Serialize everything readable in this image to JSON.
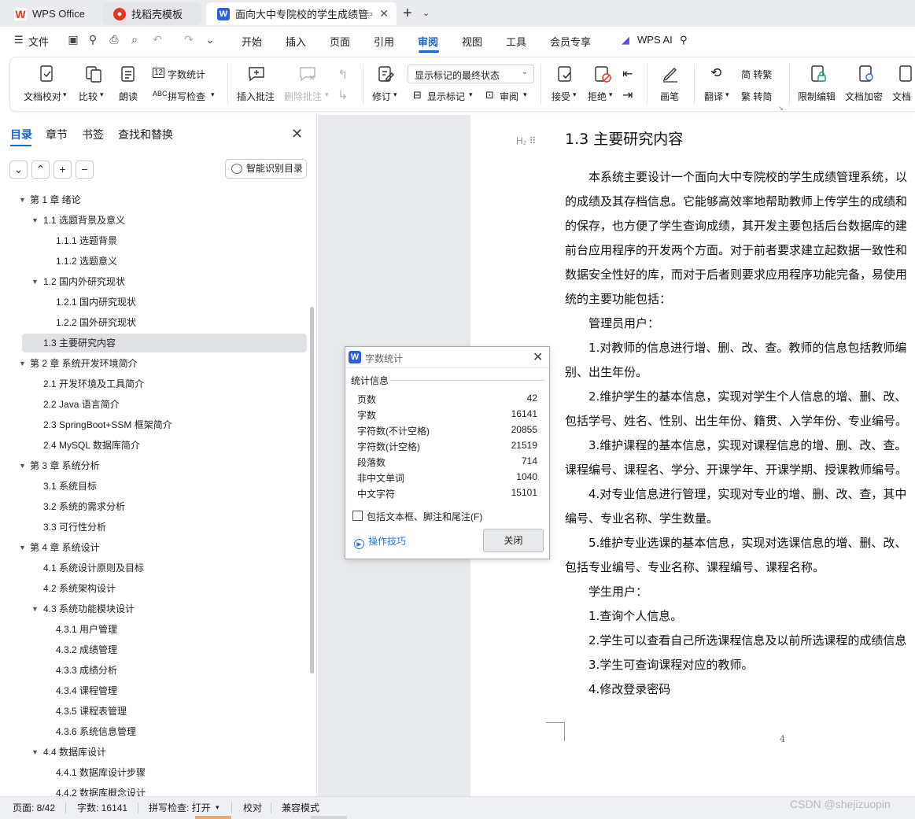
{
  "tabs": {
    "wps": "WPS Office",
    "daoke": "找稻壳模板",
    "doc": "面向大中专院校的学生成绩管理"
  },
  "menubar": {
    "file": "文件",
    "items": [
      "开始",
      "插入",
      "页面",
      "引用",
      "审阅",
      "视图",
      "工具",
      "会员专享"
    ],
    "active": "审阅",
    "wps_ai": "WPS AI"
  },
  "ribbon": {
    "doc_proofread": "文档校对",
    "compare": "比较",
    "read_aloud": "朗读",
    "word_count": "字数统计",
    "spell_check": "拼写检查",
    "insert_comment": "插入批注",
    "delete_comment": "删除批注",
    "revise": "修订",
    "display_state": "显示标记的最终状态",
    "show_markup": "显示标记",
    "review": "审阅",
    "accept": "接受",
    "reject": "拒绝",
    "pen": "画笔",
    "translate": "翻译",
    "to_traditional": "简 转繁",
    "to_simplified": "繁 转简",
    "restrict_edit": "限制编辑",
    "encrypt": "文档加密",
    "doc_more": "文档"
  },
  "nav": {
    "tabs": [
      "目录",
      "章节",
      "书签",
      "查找和替换"
    ],
    "smart_toc": "智能识别目录",
    "toc": [
      {
        "level": 1,
        "text": "第 1 章  绪论",
        "caret": true
      },
      {
        "level": 2,
        "text": "1.1  选题背景及意义",
        "caret": true
      },
      {
        "level": 3,
        "text": "1.1.1 选题背景"
      },
      {
        "level": 3,
        "text": "1.1.2 选题意义"
      },
      {
        "level": 2,
        "text": "1.2  国内外研究现状",
        "caret": true
      },
      {
        "level": 3,
        "text": "1.2.1 国内研究现状"
      },
      {
        "level": 3,
        "text": "1.2.2 国外研究现状"
      },
      {
        "level": 2,
        "text": "1.3  主要研究内容",
        "selected": true
      },
      {
        "level": 1,
        "text": "第 2 章  系统开发环境简介",
        "caret": true
      },
      {
        "level": 2,
        "text": "2.1  开发环境及工具简介"
      },
      {
        "level": 2,
        "text": "2.2 Java 语言简介"
      },
      {
        "level": 2,
        "text": "2.3 SpringBoot+SSM 框架简介"
      },
      {
        "level": 2,
        "text": "2.4 MySQL 数据库简介"
      },
      {
        "level": 1,
        "text": "第 3 章  系统分析",
        "caret": true
      },
      {
        "level": 2,
        "text": "3.1  系统目标"
      },
      {
        "level": 2,
        "text": "3.2  系统的需求分析"
      },
      {
        "level": 2,
        "text": "3.3  可行性分析"
      },
      {
        "level": 1,
        "text": "第 4 章  系统设计",
        "caret": true
      },
      {
        "level": 2,
        "text": "4.1  系统设计原则及目标"
      },
      {
        "level": 2,
        "text": "4.2  系统架构设计"
      },
      {
        "level": 2,
        "text": "4.3  系统功能模块设计",
        "caret": true
      },
      {
        "level": 3,
        "text": "4.3.1  用户管理"
      },
      {
        "level": 3,
        "text": "4.3.2  成绩管理"
      },
      {
        "level": 3,
        "text": "4.3.3  成绩分析"
      },
      {
        "level": 3,
        "text": "4.3.4  课程管理"
      },
      {
        "level": 3,
        "text": "4.3.5  课程表管理"
      },
      {
        "level": 3,
        "text": "4.3.6  系统信息管理"
      },
      {
        "level": 2,
        "text": "4.4  数据库设计",
        "caret": true
      },
      {
        "level": 3,
        "text": "4.4.1  数据库设计步骤"
      },
      {
        "level": 3,
        "text": "4.4.2  数据库概念设计"
      }
    ]
  },
  "document": {
    "heading_marker": "H₂",
    "heading": "1.3  主要研究内容",
    "lines": [
      "　　本系统主要设计一个面向大中专院校的学生成绩管理系统，以",
      "的成绩及其存档信息。它能够高效率地帮助教师上传学生的成绩和",
      "的保存，也方便了学生查询成绩，其开发主要包括后台数据库的建",
      "前台应用程序的开发两个方面。对于前者要求建立起数据一致性和",
      "数据安全性好的库，而对于后者则要求应用程序功能完备，易使用",
      "统的主要功能包括：",
      "　　管理员用户：",
      "　　1.对教师的信息进行增、删、改、查。教师的信息包括教师编",
      "别、出生年份。",
      "　　2.维护学生的基本信息，实现对学生个人信息的增、删、改、",
      "包括学号、姓名、性别、出生年份、籍贯、入学年份、专业编号。",
      "　　3.维护课程的基本信息，实现对课程信息的增、删、改、查。",
      "课程编号、课程名、学分、开课学年、开课学期、授课教师编号。",
      "　　4.对专业信息进行管理，实现对专业的增、删、改、查，其中",
      "编号、专业名称、学生数量。",
      "　　5.维护专业选课的基本信息，实现对选课信息的增、删、改、",
      "包括专业编号、专业名称、课程编号、课程名称。",
      "　　学生用户：",
      "　　1.查询个人信息。",
      "　　2.学生可以查看自己所选课程信息及以前所选课程的成绩信息",
      "　　3.学生可查询课程对应的教师。",
      "　　4.修改登录密码"
    ],
    "page_number": "4"
  },
  "dialog": {
    "title": "字数统计",
    "section": "统计信息",
    "stats": [
      {
        "label": "页数",
        "value": "42"
      },
      {
        "label": "字数",
        "value": "16141"
      },
      {
        "label": "字符数(不计空格)",
        "value": "20855"
      },
      {
        "label": "字符数(计空格)",
        "value": "21519"
      },
      {
        "label": "段落数",
        "value": "714"
      },
      {
        "label": "非中文单词",
        "value": "1040"
      },
      {
        "label": "中文字符",
        "value": "15101"
      }
    ],
    "include_label": "包括文本框、脚注和尾注(F)",
    "tips": "操作技巧",
    "close": "关闭"
  },
  "statusbar": {
    "page": "页面: 8/42",
    "words": "字数: 16141",
    "spell": "拼写检查: 打开",
    "proof": "校对",
    "compat": "兼容模式"
  },
  "watermark": "CSDN @shejizuopin",
  "colors": {
    "accent": "#1764d6",
    "wps_red": "#e8341c",
    "doc_blue": "#2c5de5"
  }
}
